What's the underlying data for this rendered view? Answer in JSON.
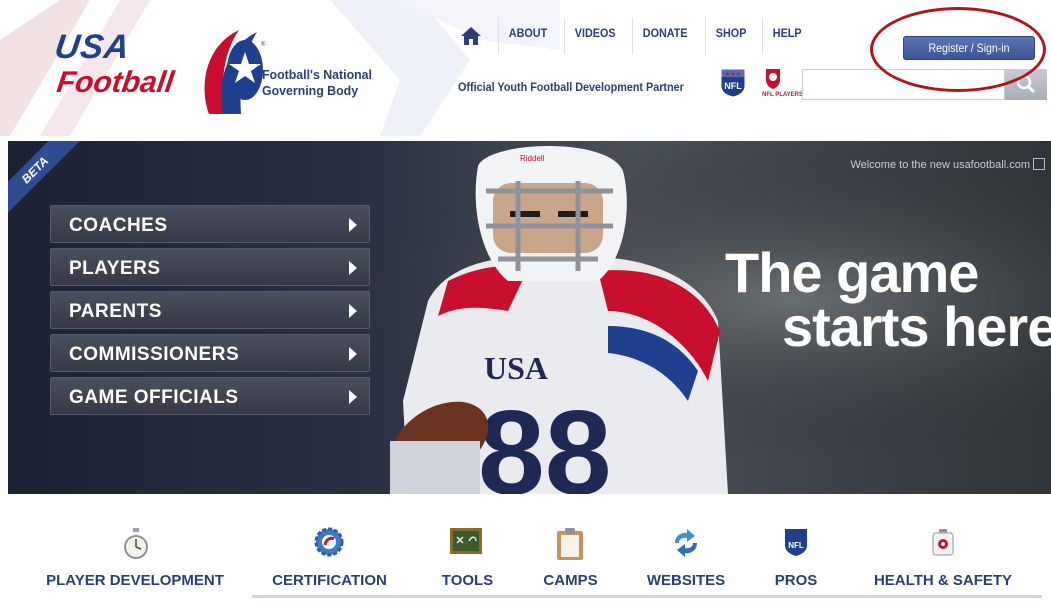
{
  "header": {
    "logo_usa": "USA",
    "logo_football": "Football",
    "tagline_line1": "Football's National",
    "tagline_line2": "Governing Body",
    "nav": [
      "ABOUT",
      "VIDEOS",
      "DONATE",
      "SHOP",
      "HELP"
    ],
    "partner_text": "Official Youth Football Development Partner",
    "nflpa_label": "NFL PLAYERS",
    "register_label": "Register / Sign-in",
    "search_placeholder": ""
  },
  "hero": {
    "beta_label": "BETA",
    "welcome_text": "Welcome to the new usafootball.com",
    "menu": [
      "COACHES",
      "PLAYERS",
      "PARENTS",
      "COMMISSIONERS",
      "GAME OFFICIALS"
    ],
    "slogan_line1": "The game",
    "slogan_line2": "starts here."
  },
  "tabs": [
    {
      "label": "PLAYER DEVELOPMENT",
      "icon": "stopwatch-icon"
    },
    {
      "label": "CERTIFICATION",
      "icon": "gear-badge-icon"
    },
    {
      "label": "TOOLS",
      "icon": "chalkboard-icon"
    },
    {
      "label": "CAMPS",
      "icon": "clipboard-icon"
    },
    {
      "label": "WEBSITES",
      "icon": "refresh-icon"
    },
    {
      "label": "PROS",
      "icon": "nfl-shield-icon"
    },
    {
      "label": "HEALTH & SAFETY",
      "icon": "first-aid-icon"
    }
  ],
  "colors": {
    "brand_blue": "#2a3f7a",
    "brand_red": "#c8102e",
    "button_blue": "#3c5596",
    "highlight_circle": "#b3141c"
  }
}
